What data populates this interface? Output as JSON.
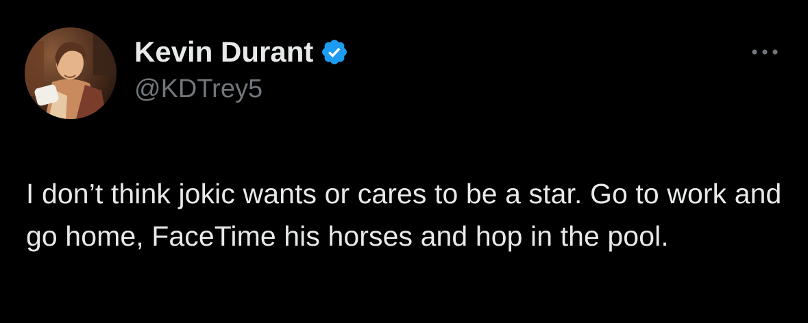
{
  "author": {
    "display_name": "Kevin Durant",
    "handle": "@KDTrey5",
    "verified": true,
    "verified_color": "#1d9bf0",
    "avatar_icon": "profile-avatar"
  },
  "tweet": {
    "text": "I don’t think jokic wants or cares to be a star. Go to work and go home, FaceTime his horses and hop in the pool."
  },
  "actions": {
    "more_icon": "more-horizontal-icon"
  },
  "theme": {
    "background": "#000000",
    "primary_text": "#e7e9ea",
    "secondary_text": "#71767b"
  }
}
